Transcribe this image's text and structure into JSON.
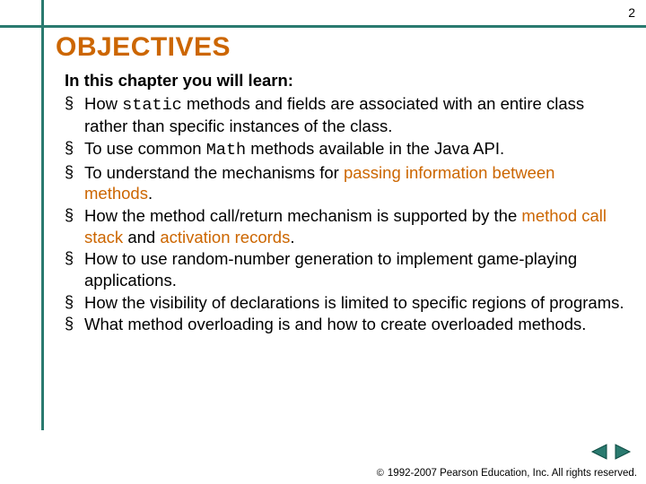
{
  "page_number": "2",
  "title": "OBJECTIVES",
  "intro": "In this chapter you will learn:",
  "items": [
    {
      "pre": "How ",
      "mono": "static",
      "post": " methods and fields are associated with an entire class rather than specific instances of the class."
    },
    {
      "pre": "To use common ",
      "mono": "Math",
      "post": " methods available in the Java API."
    },
    {
      "pre": "To understand the mechanisms for ",
      "hl1": "passing information between methods",
      "post": "."
    },
    {
      "pre": "How the method call/return mechanism is supported by the ",
      "hl1": "method call stack",
      "mid": " and ",
      "hl2": "activation records",
      "post": "."
    },
    {
      "pre": "How to use random-number generation to implement game-playing applications."
    },
    {
      "pre": "How the visibility of declarations is limited to specific regions of programs."
    },
    {
      "pre": "What method overloading is and how to create overloaded methods."
    }
  ],
  "copyright": "1992-2007 Pearson Education, Inc.  All rights reserved.",
  "colors": {
    "accent": "#cc6600",
    "rule": "#2a7a6f"
  },
  "nav": {
    "prev": "Previous slide",
    "next": "Next slide"
  }
}
